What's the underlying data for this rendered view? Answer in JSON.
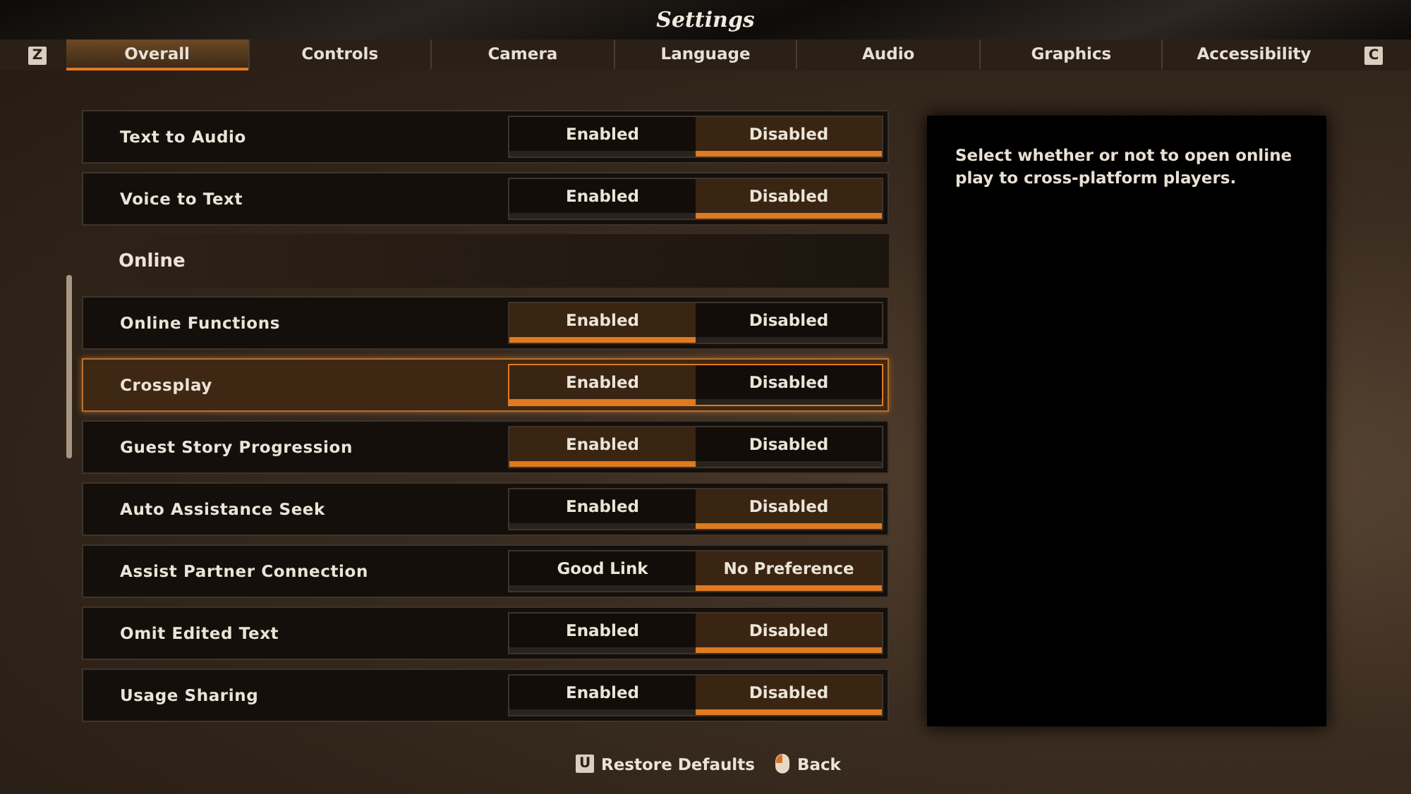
{
  "window": {
    "title": "Settings"
  },
  "tab_keys": {
    "left": "Z",
    "right": "C"
  },
  "tabs": [
    {
      "label": "Overall",
      "selected": true
    },
    {
      "label": "Controls",
      "selected": false
    },
    {
      "label": "Camera",
      "selected": false
    },
    {
      "label": "Language",
      "selected": false
    },
    {
      "label": "Audio",
      "selected": false
    },
    {
      "label": "Graphics",
      "selected": false
    },
    {
      "label": "Accessibility",
      "selected": false
    }
  ],
  "items": [
    {
      "kind": "toggle",
      "label": "Text to Audio",
      "focused": false,
      "options": [
        {
          "label": "Enabled",
          "selected": false
        },
        {
          "label": "Disabled",
          "selected": true
        }
      ]
    },
    {
      "kind": "toggle",
      "label": "Voice to Text",
      "focused": false,
      "options": [
        {
          "label": "Enabled",
          "selected": false
        },
        {
          "label": "Disabled",
          "selected": true
        }
      ]
    },
    {
      "kind": "header",
      "label": "Online"
    },
    {
      "kind": "toggle",
      "label": "Online Functions",
      "focused": false,
      "options": [
        {
          "label": "Enabled",
          "selected": true
        },
        {
          "label": "Disabled",
          "selected": false
        }
      ]
    },
    {
      "kind": "toggle",
      "label": "Crossplay",
      "focused": true,
      "options": [
        {
          "label": "Enabled",
          "selected": true
        },
        {
          "label": "Disabled",
          "selected": false
        }
      ]
    },
    {
      "kind": "toggle",
      "label": "Guest Story Progression",
      "focused": false,
      "options": [
        {
          "label": "Enabled",
          "selected": true
        },
        {
          "label": "Disabled",
          "selected": false
        }
      ]
    },
    {
      "kind": "toggle",
      "label": "Auto Assistance Seek",
      "focused": false,
      "options": [
        {
          "label": "Enabled",
          "selected": false
        },
        {
          "label": "Disabled",
          "selected": true
        }
      ]
    },
    {
      "kind": "toggle",
      "label": "Assist Partner Connection",
      "focused": false,
      "options": [
        {
          "label": "Good Link",
          "selected": false
        },
        {
          "label": "No Preference",
          "selected": true
        }
      ]
    },
    {
      "kind": "toggle",
      "label": "Omit Edited Text",
      "focused": false,
      "options": [
        {
          "label": "Enabled",
          "selected": false
        },
        {
          "label": "Disabled",
          "selected": true
        }
      ]
    },
    {
      "kind": "toggle",
      "label": "Usage Sharing",
      "focused": false,
      "options": [
        {
          "label": "Enabled",
          "selected": false
        },
        {
          "label": "Disabled",
          "selected": true
        }
      ]
    }
  ],
  "description": "Select whether or not to open online play to cross-platform players.",
  "footer": [
    {
      "kind": "key",
      "key": "U",
      "label": "Restore Defaults"
    },
    {
      "kind": "mouse",
      "label": "Back"
    }
  ]
}
